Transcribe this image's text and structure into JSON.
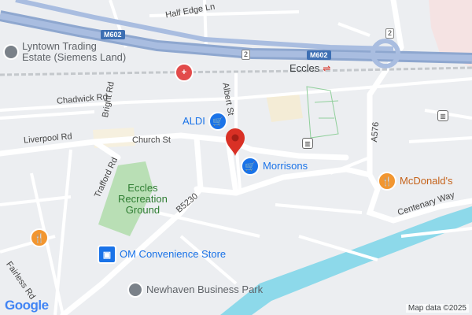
{
  "roads": {
    "half_edge_ln": "Half Edge Ln",
    "m602_a": "M602",
    "m602_b": "M602",
    "junction_2a": "2",
    "junction_2b": "2",
    "chadwick_rd": "Chadwick Rd",
    "bright_rd": "Bright Rd",
    "liverpool_rd": "Liverpool Rd",
    "church_st": "Church St",
    "albert_st": "Albert St",
    "trafford_rd": "Trafford Rd",
    "b5230": "B5230",
    "a576": "A576",
    "centenary_way": "Centenary Way",
    "fairless_rd": "Fairless Rd"
  },
  "places": {
    "lyntown": "Lyntown Trading Estate (Siemens Land)",
    "lyntown_line1": "Lyntown Trading",
    "lyntown_line2": "Estate (Siemens Land)",
    "eccles": "Eccles",
    "aldi": "ALDI",
    "morrisons": "Morrisons",
    "recreation_ground_l1": "Eccles",
    "recreation_ground_l2": "Recreation",
    "recreation_ground_l3": "Ground",
    "om_store": "OM Convenience Store",
    "newhaven": "Newhaven Business Park",
    "mcdonalds": "McDonald's"
  },
  "footer": {
    "logo": "Google",
    "map_data": "Map data ©2025"
  },
  "colors": {
    "background": "#eceef1",
    "motorway": "#8ea7cf",
    "water": "#8dd9ea",
    "park": "#b9dfb5",
    "shopping_pin": "#1a73e8",
    "food_pin": "#f29630",
    "hospital_pin": "#e24b4b",
    "place_marker": "#d93025"
  },
  "icons": [
    "hospital-icon",
    "cart-icon",
    "food-icon",
    "store-icon",
    "place-icon",
    "rail-icon",
    "transit-icon",
    "map-marker-icon"
  ]
}
